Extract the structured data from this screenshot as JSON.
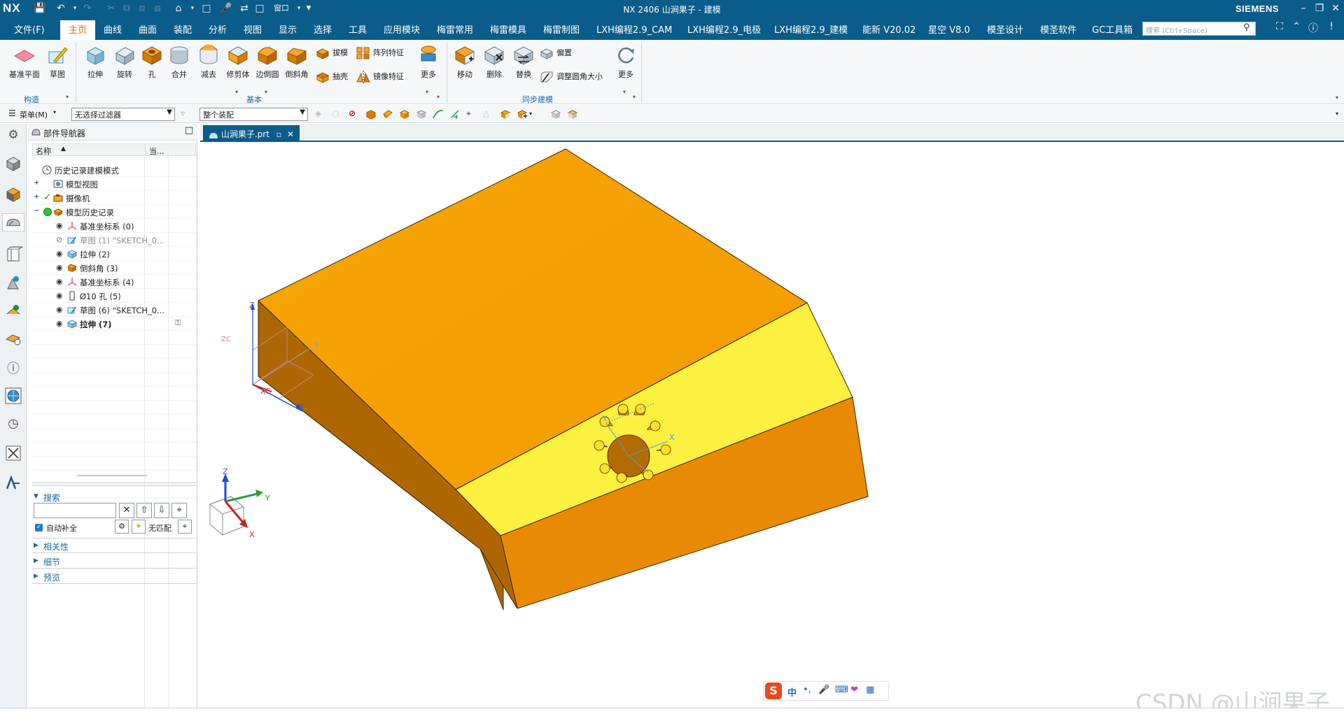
{
  "titlebar": {
    "logo": "NX",
    "title": "NX 2406 山涧果子 - 建模",
    "brand": "SIEMENS",
    "window_menu": "窗口"
  },
  "menubar": {
    "items": [
      "文件(F)",
      "主页",
      "曲线",
      "曲面",
      "装配",
      "分析",
      "视图",
      "显示",
      "选择",
      "工具",
      "应用模块",
      "梅雷常用",
      "梅雷模具",
      "梅雷制图",
      "LXH编程2.9_CAM",
      "LXH编程2.9_电极",
      "LXH编程2.9_建模",
      "能新 V20.02",
      "星空 V8.0",
      "模圣设计",
      "模圣软件",
      "GC工具箱"
    ],
    "active": "主页",
    "search_placeholder": "搜索 (Ctrl+Space)"
  },
  "ribbon": {
    "construct": {
      "label": "构造",
      "buttons": [
        "基准平面",
        "草图"
      ]
    },
    "basic": {
      "label": "基本",
      "buttons": [
        "拉伸",
        "旋转",
        "孔",
        "合并",
        "减去",
        "修剪体",
        "边倒圆",
        "倒斜角"
      ],
      "small": [
        "拔模",
        "阵列特征",
        "抽壳",
        "镜像特征"
      ],
      "more": "更多"
    },
    "sync": {
      "label": "同步建模",
      "buttons": [
        "移动",
        "删除",
        "替换"
      ],
      "small": [
        "偏置",
        "调整圆角大小"
      ],
      "more": "更多"
    }
  },
  "selbar": {
    "menu_label": "菜单(M)",
    "filter": "无选择过滤器",
    "assembly": "整个装配"
  },
  "navigator": {
    "title": "部件导航器",
    "col_name": "名称",
    "col_current": "当...",
    "rows": [
      {
        "label": "历史记录建模模式",
        "type": "clock"
      },
      {
        "label": "模型视图",
        "type": "view"
      },
      {
        "label": "摄像机",
        "type": "camera"
      },
      {
        "label": "模型历史记录",
        "type": "history"
      },
      {
        "label": "基准坐标系 (0)",
        "type": "csys"
      },
      {
        "label": "草图 (1) \"SKETCH_0...",
        "type": "sketch",
        "hidden": true
      },
      {
        "label": "拉伸 (2)",
        "type": "extrude"
      },
      {
        "label": "倒斜角 (3)",
        "type": "chamfer"
      },
      {
        "label": "基准坐标系 (4)",
        "type": "csys"
      },
      {
        "label": "Ø10 孔 (5)",
        "type": "hole"
      },
      {
        "label": "草图 (6) \"SKETCH_0...",
        "type": "sketch"
      },
      {
        "label": "拉伸 (7)",
        "type": "extrude",
        "bold": true
      }
    ],
    "search_label": "搜索",
    "auto_complete": "自动补全",
    "no_match": "无匹配",
    "sections": [
      "相关性",
      "细节",
      "预览"
    ]
  },
  "graphics": {
    "tab_label": "山涧果子.prt",
    "axis_labels": {
      "x": "X",
      "y": "Y",
      "z": "Z",
      "xc": "XC",
      "zc": "ZC"
    },
    "colors": {
      "body_top": "#f6a204",
      "body_side": "#ad6600",
      "body_front": "#e98a04",
      "chamfer": "#fcf040",
      "hole": "#b36a00",
      "pin": "#fde02d"
    }
  },
  "ime": {
    "lang": "中"
  },
  "watermark": "CSDN @山涧果子"
}
